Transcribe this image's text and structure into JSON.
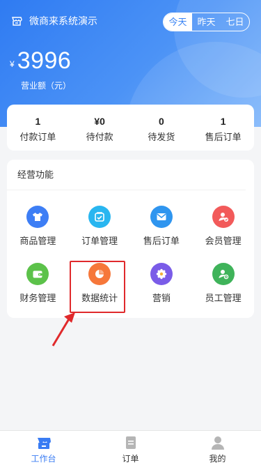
{
  "header": {
    "store_name": "微商来系统演示",
    "periods": [
      "今天",
      "昨天",
      "七日"
    ],
    "active_period": "今天"
  },
  "revenue": {
    "currency": "¥",
    "amount": "3996",
    "label": "营业额（元）"
  },
  "stats": [
    {
      "value": "1",
      "label": "付款订单"
    },
    {
      "value": "¥0",
      "label": "待付款"
    },
    {
      "value": "0",
      "label": "待发货"
    },
    {
      "value": "1",
      "label": "售后订单"
    }
  ],
  "functions": {
    "title": "经营功能",
    "items": [
      {
        "label": "商品管理",
        "icon": "shirt-icon",
        "color": "#3d7ef5"
      },
      {
        "label": "订单管理",
        "icon": "cart-icon",
        "color": "#29b6f0"
      },
      {
        "label": "售后订单",
        "icon": "mail-icon",
        "color": "#2f95ef"
      },
      {
        "label": "会员管理",
        "icon": "member-icon",
        "color": "#f25a5a"
      },
      {
        "label": "财务管理",
        "icon": "wallet-icon",
        "color": "#5cc24a"
      },
      {
        "label": "数据统计",
        "icon": "pie-chart-icon",
        "color": "#f6773a"
      },
      {
        "label": "营销",
        "icon": "flower-icon",
        "color": "#7a5ce8"
      },
      {
        "label": "员工管理",
        "icon": "staff-icon",
        "color": "#3fb35a"
      }
    ]
  },
  "tabbar": {
    "items": [
      {
        "label": "工作台",
        "icon": "store-icon",
        "active": true
      },
      {
        "label": "订单",
        "icon": "document-icon",
        "active": false
      },
      {
        "label": "我的",
        "icon": "user-icon",
        "active": false
      }
    ],
    "active_color": "#3a7cf3",
    "inactive_color": "#b5b5b5"
  }
}
